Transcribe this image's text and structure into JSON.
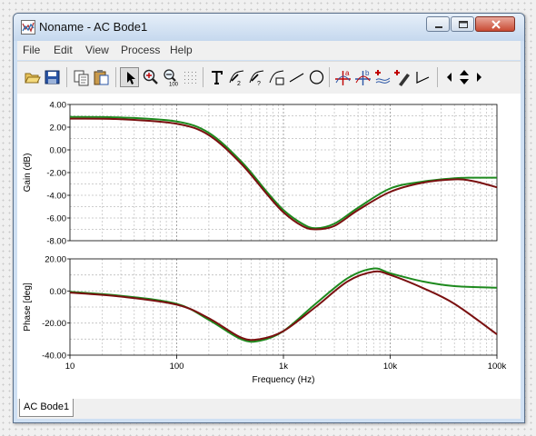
{
  "window": {
    "title": "Noname - AC Bode1"
  },
  "menu": [
    "File",
    "Edit",
    "View",
    "Process",
    "Help"
  ],
  "tabs": [
    {
      "label": "AC Bode1"
    }
  ],
  "colors": {
    "series_green": "#1e8a1e",
    "series_red": "#7a1010"
  },
  "chart_data": [
    {
      "type": "line",
      "ylabel": "Gain (dB)",
      "xscale": "log",
      "xlim": [
        10,
        100000
      ],
      "ylim": [
        -8,
        4
      ],
      "yticks": [
        "4.00",
        "2.00",
        "0.00",
        "-2.00",
        "-4.00",
        "-6.00",
        "-8.00"
      ],
      "grid": true,
      "series": [
        {
          "color": "green",
          "x": [
            10,
            30,
            100,
            200,
            400,
            700,
            1000,
            1500,
            2000,
            3000,
            5000,
            10000,
            20000,
            40000,
            60000,
            100000
          ],
          "y": [
            2.9,
            2.85,
            2.5,
            1.5,
            -1.0,
            -3.7,
            -5.3,
            -6.5,
            -6.9,
            -6.5,
            -5.1,
            -3.4,
            -2.8,
            -2.5,
            -2.45,
            -2.45
          ]
        },
        {
          "color": "red",
          "x": [
            10,
            30,
            100,
            200,
            400,
            700,
            1000,
            1500,
            2000,
            3000,
            5000,
            10000,
            20000,
            40000,
            60000,
            100000
          ],
          "y": [
            2.75,
            2.7,
            2.3,
            1.3,
            -1.2,
            -3.9,
            -5.5,
            -6.7,
            -7.0,
            -6.7,
            -5.3,
            -3.7,
            -2.9,
            -2.6,
            -2.75,
            -3.3
          ]
        }
      ]
    },
    {
      "type": "line",
      "xlabel": "Frequency (Hz)",
      "ylabel": "Phase [deg]",
      "xscale": "log",
      "xlim": [
        10,
        100000
      ],
      "ylim": [
        -40,
        20
      ],
      "yticks": [
        "20.00",
        "0.00",
        "-20.00",
        "-40.00"
      ],
      "xticks": [
        "10",
        "100",
        "1k",
        "10k",
        "100k"
      ],
      "grid": true,
      "series": [
        {
          "color": "green",
          "x": [
            10,
            30,
            100,
            200,
            400,
            600,
            1000,
            2000,
            4000,
            7000,
            10000,
            20000,
            40000,
            100000
          ],
          "y": [
            -0.5,
            -3,
            -8,
            -18,
            -30,
            -31,
            -25,
            -8,
            8,
            14,
            11,
            6,
            3,
            2
          ]
        },
        {
          "color": "red",
          "x": [
            10,
            30,
            100,
            200,
            400,
            600,
            1000,
            2000,
            4000,
            7000,
            10000,
            20000,
            40000,
            100000
          ],
          "y": [
            -1,
            -3.5,
            -8.5,
            -17,
            -29,
            -30,
            -25,
            -10,
            6,
            12,
            10,
            2,
            -8,
            -27
          ]
        }
      ]
    }
  ]
}
